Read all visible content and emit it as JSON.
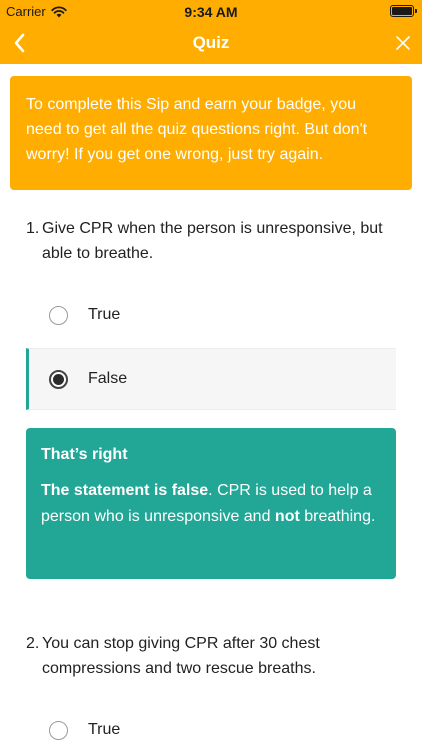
{
  "status": {
    "carrier": "Carrier",
    "time": "9:34 AM"
  },
  "nav": {
    "title": "Quiz",
    "back_icon": "chevron-left-icon",
    "close_icon": "close-icon"
  },
  "intro": {
    "text": "To complete this Sip and earn your badge, you need to get all the quiz questions right. But don't worry! If you get one wrong, just try again."
  },
  "questions": [
    {
      "number": "1.",
      "text": "Give CPR when the person is unresponsive, but able to breathe.",
      "options": [
        {
          "label": "True",
          "selected": false
        },
        {
          "label": "False",
          "selected": true
        }
      ],
      "feedback": {
        "title": "That’s right",
        "bold_lead": "The statement is false",
        "body_1": ". CPR is used to help a person who is unresponsive and ",
        "bold_not": "not",
        "body_2": " breathing."
      }
    },
    {
      "number": "2.",
      "text": "You can stop giving CPR after 30 chest compressions and two rescue breaths.",
      "options": [
        {
          "label": "True",
          "selected": false
        }
      ]
    }
  ],
  "colors": {
    "accent": "#ffad00",
    "success": "#22a797"
  }
}
